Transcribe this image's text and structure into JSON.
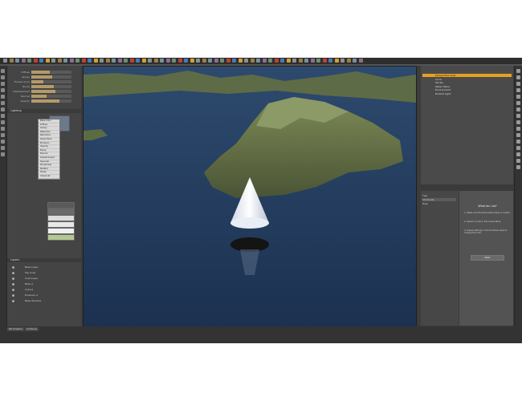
{
  "toolbar": {
    "icons": [
      "select-icon",
      "move-icon",
      "rotate-icon",
      "scale-icon",
      "universal-icon",
      "render-icon",
      "camera-icon",
      "light-icon"
    ]
  },
  "parameters": {
    "sliders": [
      {
        "label": "Diffuse",
        "level": 0.45
      },
      {
        "label": "Glossy",
        "level": 0.52
      },
      {
        "label": "Translucency",
        "level": 0.3
      },
      {
        "label": "Bump",
        "level": 0.55
      },
      {
        "label": "Displacement",
        "level": 0.6
      },
      {
        "label": "Normal",
        "level": 0.38
      },
      {
        "label": "Opacity",
        "level": 0.7
      }
    ],
    "section_lighting": "Lighting",
    "section_layers": "Layers",
    "dropdown_items": [
      "Base Color",
      "Diffuse",
      "Glossy",
      "Reflection",
      "Refraction",
      "Subsurface",
      "Emission",
      "Opacity",
      "Bump",
      "Normal",
      "Displacement",
      "Specular",
      "Roughness",
      "Metallic",
      "Sheen",
      "Clearcoat"
    ],
    "layer_rows": [
      "Base Layer",
      "Top Coat",
      "Coat Layer",
      "Base 2",
      "Cutout",
      "Emission 2",
      "Base Shadow"
    ]
  },
  "scene": {
    "rows": [
      {
        "label": "Perspective View",
        "selected": true
      },
      {
        "label": "Cone",
        "selected": false
      },
      {
        "label": "Terrain",
        "selected": false
      },
      {
        "label": "Water Plane",
        "selected": false
      },
      {
        "label": "Environment",
        "selected": false
      },
      {
        "label": "Distant Light",
        "selected": false
      }
    ]
  },
  "tips": {
    "title": "What do I do?",
    "steps": [
      "1. Make sure the Parameters Pane is visible.",
      "2. Select a node in the Scene Pane.",
      "3. Adjust settings in the Surfaces pane to change the look."
    ],
    "button_label": "Next",
    "list_items": [
      "Tips",
      "Shortcuts",
      "Help"
    ]
  },
  "status": {
    "tabs": [
      "Parameters",
      "Surfaces"
    ]
  },
  "colors": {
    "accent": "#e6a020",
    "panel": "#444444",
    "taskbar": "#1c2030"
  }
}
